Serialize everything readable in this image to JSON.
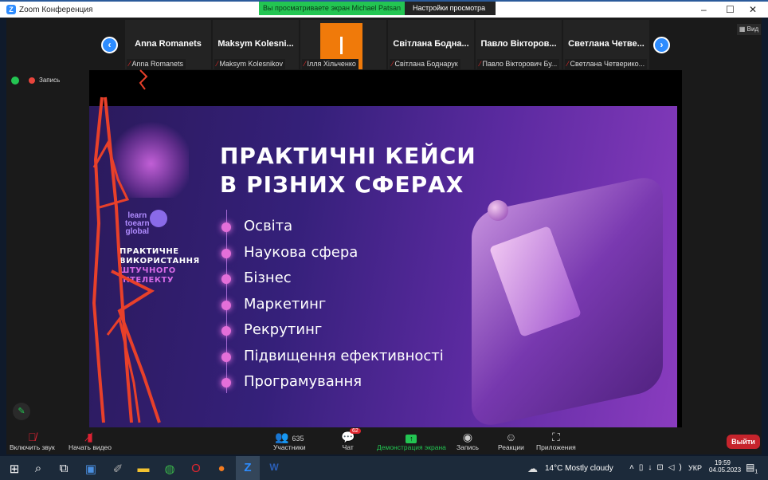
{
  "window": {
    "title": "Zoom Конференция",
    "minimize": "–",
    "maximize": "☐",
    "close": "✕"
  },
  "banner": {
    "text": "Вы просматриваете экран Michael Patsan",
    "settings": "Настройки просмотра",
    "chevron": "⌄"
  },
  "view_button": "Вид",
  "participants_strip": [
    {
      "name": "Anna Romanets",
      "label": "Anna Romanets"
    },
    {
      "name": "Maksym Kolesni...",
      "label": "Maksym Kolesnikov"
    },
    {
      "name": "",
      "label": "Ілля Хільченко"
    },
    {
      "name": "Світлана Бодна...",
      "label": "Світлана Боднарук"
    },
    {
      "name": "Павло Вікторов...",
      "label": "Павло Вікторович Бу..."
    },
    {
      "name": "Светлана Четве...",
      "label": "Светлана Четверико..."
    }
  ],
  "recording": "Запись",
  "slide": {
    "title_lines": [
      "ПРАКТИЧНІ КЕЙСИ",
      "В РІЗНИХ СФЕРАХ"
    ],
    "bullets": [
      "Освіта",
      "Наукова сфера",
      "Бізнес",
      "Маркетинг",
      "Рекрутинг",
      "Підвищення ефективності",
      "Програмування"
    ],
    "logo": [
      "learn",
      "toearn",
      "global"
    ],
    "side_text": [
      "ПРАКТИЧНЕ",
      "ВИКОРИСТАННЯ",
      "ШТУЧНОГО",
      "ІНТЕЛЕКТУ"
    ]
  },
  "toolbar": {
    "unmute": "Включить звук",
    "video": "Начать видео",
    "participants": "Участники",
    "participants_count": "635",
    "chat": "Чат",
    "chat_badge": "62",
    "share": "Демонстрация экрана",
    "record": "Запись",
    "reactions": "Реакции",
    "apps": "Приложения",
    "leave": "Выйти"
  },
  "taskbar": {
    "weather": "14°C  Mostly cloudy",
    "lang": "УКР",
    "time": "19:59",
    "date": "04.05.2023",
    "notif": "1"
  }
}
